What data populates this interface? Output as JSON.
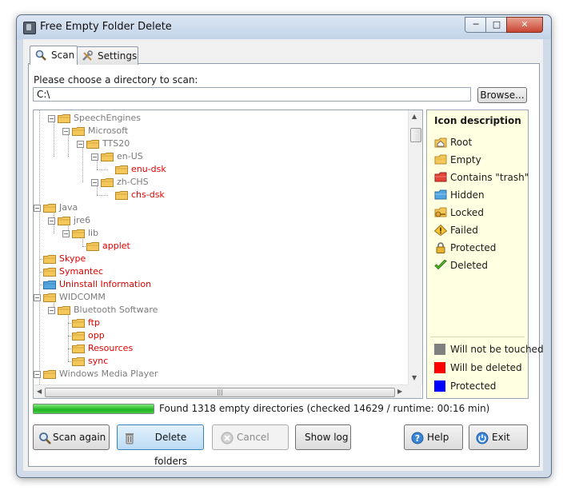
{
  "window": {
    "title": "Free Empty Folder Delete"
  },
  "tabs": [
    {
      "label": "Scan"
    },
    {
      "label": "Settings"
    }
  ],
  "scan": {
    "choose_label": "Please choose a directory to scan:",
    "path_value": "C:\\",
    "browse_label": "Browse..."
  },
  "tree": [
    {
      "label": "SpeechEngines",
      "color": "gray"
    },
    {
      "label": "Microsoft",
      "color": "gray"
    },
    {
      "label": "TTS20",
      "color": "gray"
    },
    {
      "label": "en-US",
      "color": "gray"
    },
    {
      "label": "enu-dsk",
      "color": "red"
    },
    {
      "label": "zh-CHS",
      "color": "gray"
    },
    {
      "label": "chs-dsk",
      "color": "red"
    },
    {
      "label": "Java",
      "color": "gray"
    },
    {
      "label": "jre6",
      "color": "gray"
    },
    {
      "label": "lib",
      "color": "gray"
    },
    {
      "label": "applet",
      "color": "red"
    },
    {
      "label": "Skype",
      "color": "red"
    },
    {
      "label": "Symantec",
      "color": "red"
    },
    {
      "label": "Uninstall Information",
      "color": "red"
    },
    {
      "label": "WIDCOMM",
      "color": "gray"
    },
    {
      "label": "Bluetooth Software",
      "color": "gray"
    },
    {
      "label": "ftp",
      "color": "red"
    },
    {
      "label": "opp",
      "color": "red"
    },
    {
      "label": "Resources",
      "color": "red"
    },
    {
      "label": "sync",
      "color": "red"
    },
    {
      "label": "Windows Media Player",
      "color": "gray"
    }
  ],
  "legend": {
    "title": "Icon description",
    "items": [
      {
        "label": "Root",
        "icon": "root-folder-icon"
      },
      {
        "label": "Empty",
        "icon": "empty-folder-icon"
      },
      {
        "label": "Contains \"trash\"",
        "icon": "trash-folder-icon"
      },
      {
        "label": "Hidden",
        "icon": "hidden-folder-icon"
      },
      {
        "label": "Locked",
        "icon": "locked-folder-icon"
      },
      {
        "label": "Failed",
        "icon": "warning-icon"
      },
      {
        "label": "Protected",
        "icon": "padlock-icon"
      },
      {
        "label": "Deleted",
        "icon": "checkmark-icon"
      }
    ],
    "colors": [
      {
        "label": "Will not be touched",
        "color": "#808080"
      },
      {
        "label": "Will be deleted",
        "color": "#ff0000"
      },
      {
        "label": "Protected",
        "color": "#0000ff"
      }
    ]
  },
  "status": {
    "progress_fraction": 1.0,
    "text": "Found 1318 empty directories (checked 14629 / runtime: 00:16 min)"
  },
  "buttons": {
    "scan_again": "Scan again",
    "delete_folders": "Delete folders",
    "cancel": "Cancel",
    "show_log": "Show log",
    "help": "Help",
    "exit": "Exit"
  },
  "colors": {
    "folder_yellow": "#f3c75a",
    "folder_red": "#e2443a",
    "folder_blue": "#55a6e0",
    "delete_button_bg": "#cfe6fb"
  }
}
